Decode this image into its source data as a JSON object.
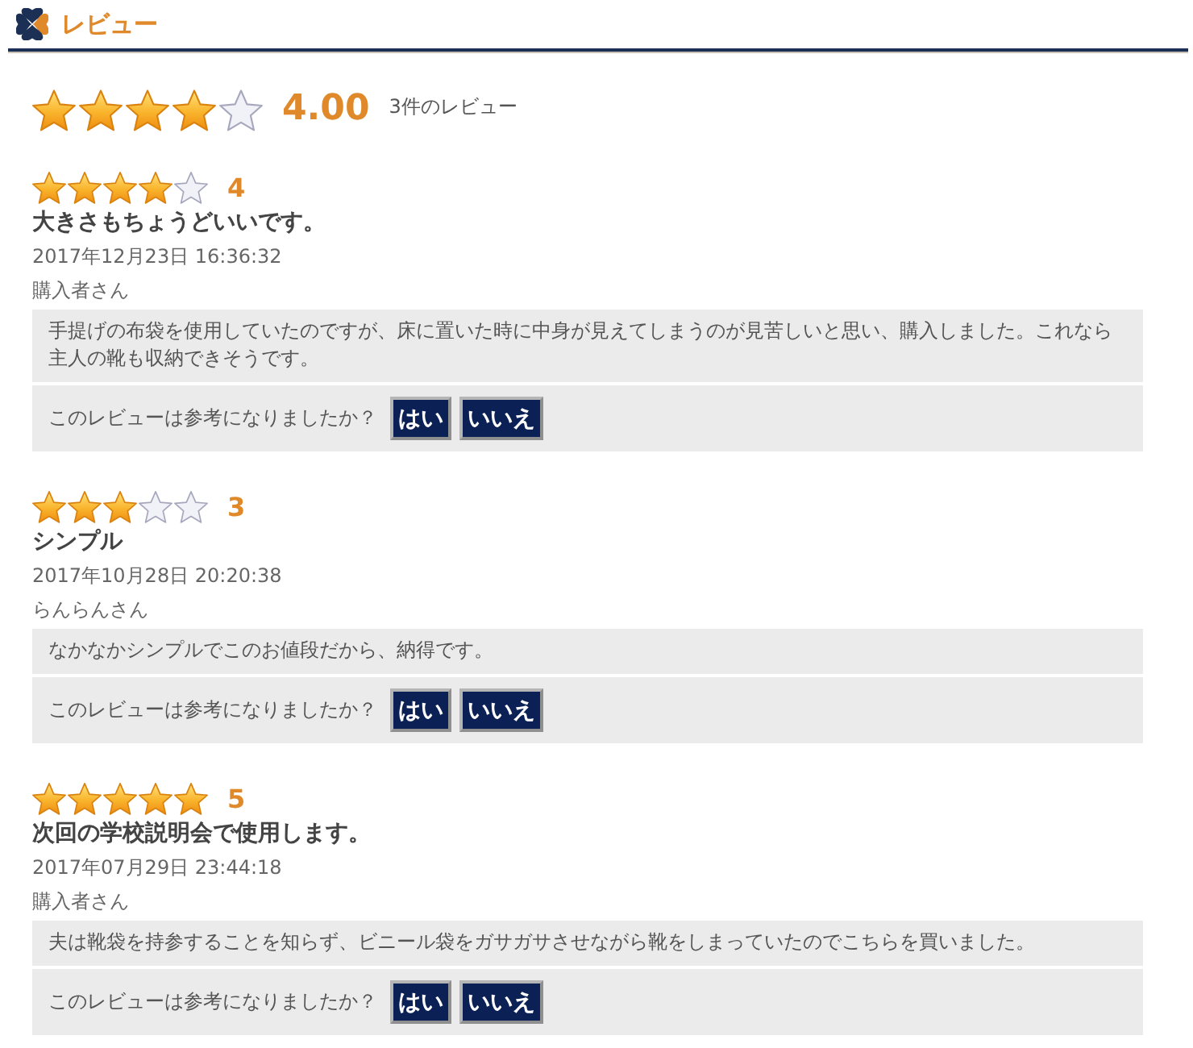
{
  "header": {
    "title": "レビュー"
  },
  "summary": {
    "stars": 4,
    "score": "4.00",
    "count": "3件のレビュー"
  },
  "reviews": [
    {
      "stars": 4,
      "score": "4",
      "title": "大きさもちょうどいいです。",
      "date": "2017年12月23日 16:36:32",
      "author": "購入者さん",
      "comment": "手提げの布袋を使用していたのですが、床に置いた時に中身が見えてしまうのが見苦しいと思い、購入しました。これなら主人の靴も収納できそうです。",
      "question": "このレビューは参考になりましたか？",
      "buttons": [
        "はい",
        "いいえ"
      ]
    },
    {
      "stars": 3,
      "score": "3",
      "title": "シンプル",
      "date": "2017年10月28日 20:20:38",
      "author": "らんらんさん",
      "comment": "なかなかシンプルでこのお値段だから、納得です。",
      "question": "このレビューは参考になりましたか？",
      "buttons": [
        "はい",
        "いいえ"
      ]
    },
    {
      "stars": 5,
      "score": "5",
      "title": "次回の学校説明会で使用します。",
      "date": "2017年07月29日 23:44:18",
      "author": "購入者さん",
      "comment": "夫は靴袋を持参することを知らず、ビニール袋をガサガサさせながら靴をしまっていたのでこちらを買いました。",
      "question": "このレビューは参考になりましたか？",
      "buttons": [
        "はい",
        "いいえ"
      ]
    }
  ]
}
